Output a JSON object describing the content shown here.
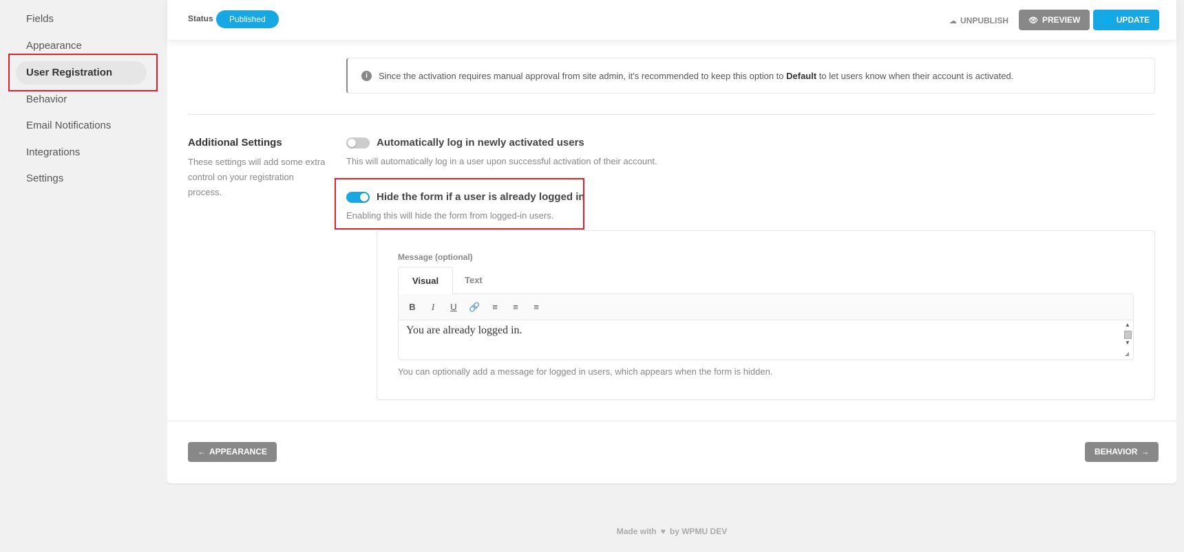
{
  "sidebar": {
    "items": [
      {
        "label": "Fields"
      },
      {
        "label": "Appearance"
      },
      {
        "label": "User Registration",
        "active": true
      },
      {
        "label": "Behavior"
      },
      {
        "label": "Email Notifications"
      },
      {
        "label": "Integrations"
      },
      {
        "label": "Settings"
      }
    ]
  },
  "header": {
    "status_label": "Status",
    "status_value": "Published",
    "unpublish_label": "UNPUBLISH",
    "preview_label": "PREVIEW",
    "update_label": "UPDATE"
  },
  "notice": {
    "text_before": "Since the activation requires manual approval from site admin, it's recommended to keep this option to ",
    "text_bold": "Default",
    "text_after": " to let users know when their account is activated."
  },
  "additional_settings": {
    "title": "Additional Settings",
    "description": "These settings will add some extra control on your registration process.",
    "options": [
      {
        "label": "Automatically log in newly activated users",
        "description": "This will automatically log in a user upon successful activation of their account.",
        "enabled": false
      },
      {
        "label": "Hide the form if a user is already logged in",
        "description": "Enabling this will hide the form from logged-in users.",
        "enabled": true
      }
    ]
  },
  "message": {
    "label": "Message (optional)",
    "tabs": [
      "Visual",
      "Text"
    ],
    "active_tab": "Visual",
    "toolbar": [
      "bold-icon",
      "italic-icon",
      "underline-icon",
      "link-icon",
      "align-left-icon",
      "align-center-icon",
      "align-right-icon"
    ],
    "content": "You are already logged in.",
    "help": "You can optionally add a message for logged in users, which appears when the form is hidden."
  },
  "navigation": {
    "prev_label": "APPEARANCE",
    "next_label": "BEHAVIOR"
  },
  "footer": {
    "made_with": "Made with",
    "by": "by WPMU DEV"
  },
  "colors": {
    "accent": "#17a8e3",
    "highlight": "#e0202a",
    "gray_button": "#888888"
  }
}
